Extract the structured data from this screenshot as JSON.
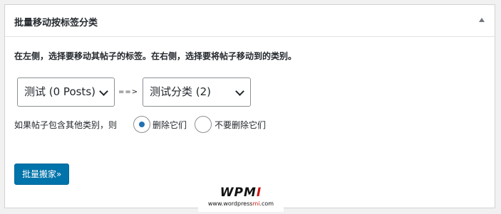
{
  "panel": {
    "title": "批量移动按标签分类",
    "instruction": "在左侧，选择要移动其帖子的标签。在右侧，选择要将帖子移动到的类别。",
    "from_select": {
      "selected": "测试 (0 Posts)"
    },
    "separator": "==>",
    "to_select": {
      "selected": "测试分类  (2)"
    },
    "radio_lead": "如果帖子包含其他类别，则",
    "radio_options": [
      {
        "label": "删除它们",
        "checked": true
      },
      {
        "label": "不要删除它们",
        "checked": false
      }
    ],
    "submit_label": "批量搬家»"
  },
  "watermark": {
    "logo_main": "WPM",
    "logo_accent": "I",
    "url_main": "www.wordpress",
    "url_accent": "mi",
    "url_tail": ".com"
  },
  "colors": {
    "primary_button": "#0073aa",
    "radio_checked": "#2271b1",
    "watermark_accent": "#d01818"
  }
}
